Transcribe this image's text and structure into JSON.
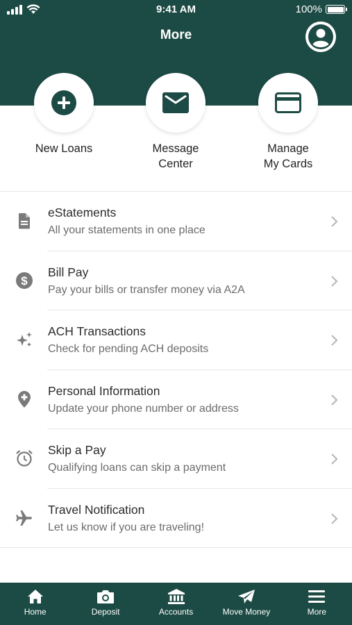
{
  "status_bar": {
    "time": "9:41 AM",
    "battery": "100%"
  },
  "header": {
    "title": "More"
  },
  "quick_actions": [
    {
      "label": "New Loans",
      "icon": "plus-circle-icon"
    },
    {
      "label": "Message Center",
      "icon": "envelope-icon"
    },
    {
      "label": "Manage My Cards",
      "icon": "credit-card-icon"
    }
  ],
  "menu": [
    {
      "title": "eStatements",
      "subtitle": "All your statements in one place",
      "icon": "document-icon"
    },
    {
      "title": "Bill Pay",
      "subtitle": "Pay your bills or transfer money via A2A",
      "icon": "dollar-circle-icon"
    },
    {
      "title": "ACH Transactions",
      "subtitle": "Check for pending ACH deposits",
      "icon": "sparkle-icon"
    },
    {
      "title": "Personal Information",
      "subtitle": "Update your phone number or address",
      "icon": "location-plus-icon"
    },
    {
      "title": "Skip a Pay",
      "subtitle": "Qualifying loans can skip a payment",
      "icon": "alarm-clock-icon"
    },
    {
      "title": "Travel Notification",
      "subtitle": "Let us know if you are traveling!",
      "icon": "airplane-icon"
    }
  ],
  "tabs": [
    {
      "label": "Home",
      "icon": "home-icon"
    },
    {
      "label": "Deposit",
      "icon": "camera-icon"
    },
    {
      "label": "Accounts",
      "icon": "bank-icon"
    },
    {
      "label": "Move Money",
      "icon": "send-icon"
    },
    {
      "label": "More",
      "icon": "menu-icon",
      "active": true
    }
  ],
  "colors": {
    "brand": "#1c4a44",
    "text": "#2b2b2b",
    "subtext": "#6b6b6b",
    "icon_gray": "#7a7a7a"
  }
}
